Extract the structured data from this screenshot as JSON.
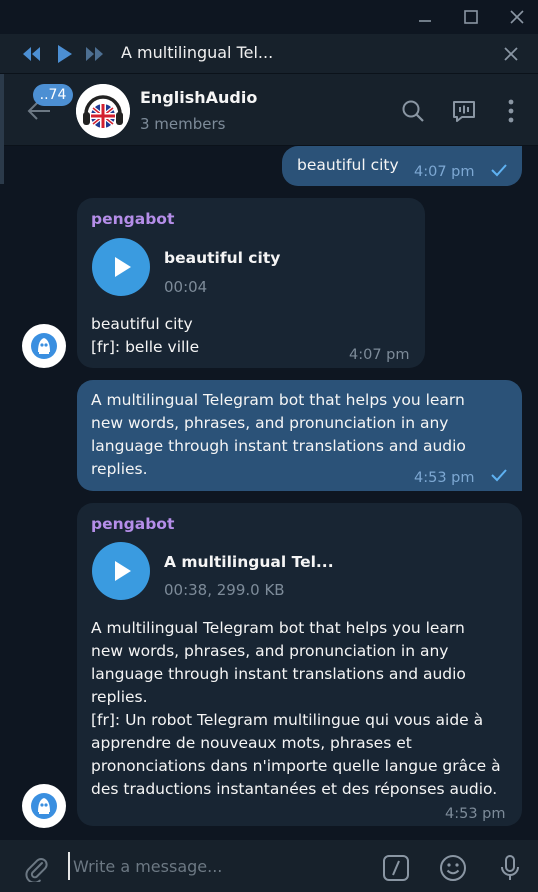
{
  "window": {
    "minimize_icon": "minimize-icon",
    "maximize_icon": "maximize-icon",
    "close_icon": "close-icon"
  },
  "player": {
    "title": "A multilingual Tel...",
    "controls": [
      "previous-icon",
      "play-icon",
      "next-icon"
    ]
  },
  "header": {
    "unread_badge": "..74",
    "chat_name": "EnglishAudio",
    "members": "3 members",
    "actions": [
      "search-icon",
      "voice-chat-icon",
      "more-icon"
    ]
  },
  "messages": [
    {
      "direction": "out",
      "text": "beautiful city",
      "time": "4:07 pm"
    },
    {
      "direction": "in",
      "sender": "pengabot",
      "audio_title": "beautiful city",
      "audio_meta": "00:04",
      "text": "beautiful city\n[fr]: belle ville",
      "time": "4:07 pm"
    },
    {
      "direction": "out",
      "text": "A multilingual Telegram bot that helps you learn\nnew words, phrases, and pronunciation in any\nlanguage through instant translations and audio\nreplies.",
      "time": "4:53 pm"
    },
    {
      "direction": "in",
      "sender": "pengabot",
      "audio_title": "A multilingual Tel...",
      "audio_meta": "00:38, 299.0 KB",
      "text": "A multilingual Telegram bot that helps you learn\nnew words, phrases, and pronunciation in any\nlanguage through instant translations and audio\nreplies.\n[fr]: Un robot Telegram multilingue qui vous aide à\napprendre de nouveaux mots, phrases et\nprononciations dans n'importe quelle langue grâce à\ndes traductions instantanées et des réponses audio.",
      "time": "4:53 pm"
    }
  ],
  "composer": {
    "placeholder": "Write a message...",
    "icons": [
      "attach-icon",
      "commands-icon",
      "emoji-icon",
      "microphone-icon"
    ]
  },
  "colors": {
    "background": "#0e1621",
    "panel": "#17212b",
    "outgoing_bubble": "#2b5278",
    "incoming_bubble": "#182533",
    "accent": "#3a9be0",
    "sender_name": "#b58ee9"
  }
}
